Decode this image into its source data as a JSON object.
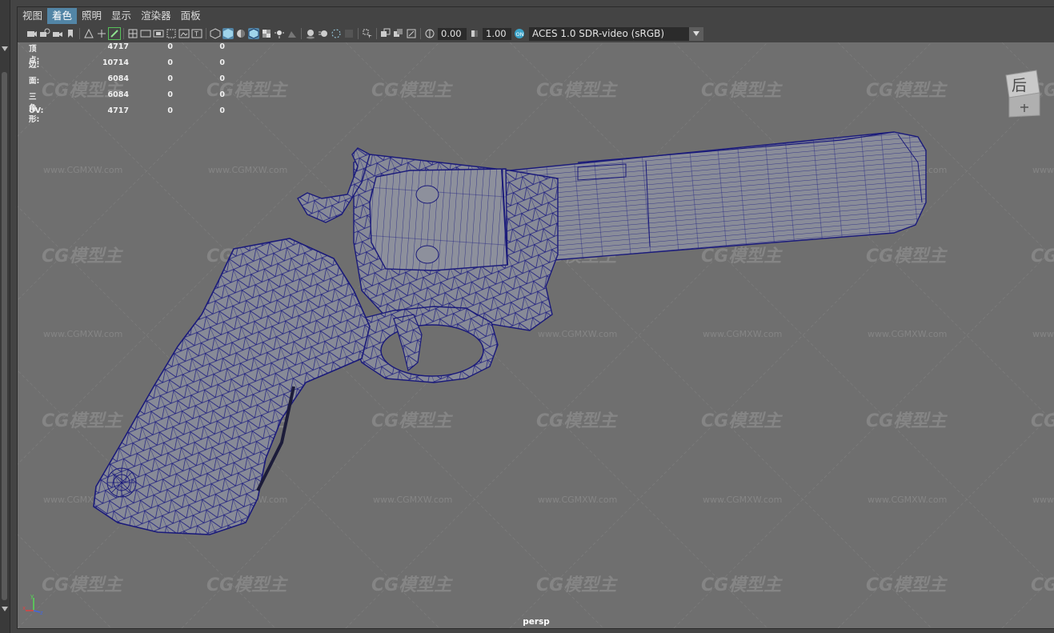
{
  "menubar": {
    "items": [
      "视图",
      "着色",
      "照明",
      "显示",
      "渲染器",
      "面板"
    ],
    "active_index": 1
  },
  "toolbar": {
    "exposure_value": "0.00",
    "gamma_value": "1.00",
    "color_space": "ACES 1.0 SDR-video (sRGB)"
  },
  "hud": {
    "rows": [
      {
        "label": "顶点:",
        "v1": "4717",
        "v2": "0",
        "v3": "0"
      },
      {
        "label": "边:",
        "v1": "10714",
        "v2": "0",
        "v3": "0"
      },
      {
        "label": "面:",
        "v1": "6084",
        "v2": "0",
        "v3": "0"
      },
      {
        "label": "三角形:",
        "v1": "6084",
        "v2": "0",
        "v3": "0"
      },
      {
        "label": "UV:",
        "v1": "4717",
        "v2": "0",
        "v3": "0"
      }
    ]
  },
  "viewcube": {
    "face_label": "后"
  },
  "camera_label": "persp",
  "watermark": {
    "logo_text": "CG模型主",
    "url_text": "www.CGMXW.com"
  },
  "colors": {
    "menu_active": "#5285a6",
    "viewport_bg": "#6f6f6f",
    "wireframe": "#1a1a7a",
    "model_fill": "#8a8d99"
  }
}
